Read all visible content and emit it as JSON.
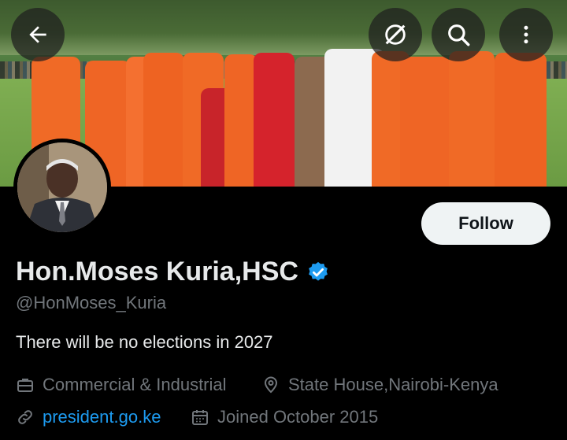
{
  "header": {
    "back_icon": "arrow-left-icon",
    "grok_icon": "slash-circle-icon",
    "search_icon": "search-icon",
    "more_icon": "more-vertical-icon"
  },
  "profile": {
    "follow_label": "Follow",
    "name": "Hon.Moses Kuria,HSC",
    "verified_color": "#1d9bf0",
    "handle": "@HonMoses_Kuria",
    "bio": "There will be no elections in 2027",
    "category": "Commercial & Industrial",
    "location": "State House,Nairobi-Kenya",
    "website": "president.go.ke",
    "joined": "Joined October 2015"
  },
  "colors": {
    "background": "#000000",
    "text_primary": "#e7e9ea",
    "text_secondary": "#71767b",
    "link": "#1d9bf0"
  }
}
